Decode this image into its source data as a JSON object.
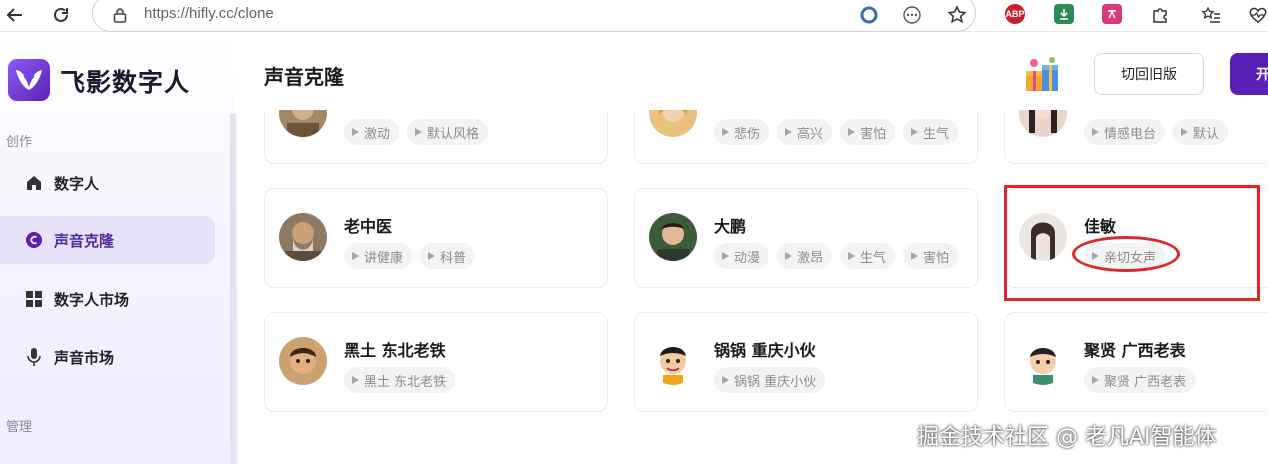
{
  "browser": {
    "url": "https://hifly.cc/clone",
    "extensions": [
      "ABP",
      "download",
      "translate",
      "puzzle",
      "favorites",
      "heartbeat"
    ]
  },
  "brand": {
    "name": "飞影数字人"
  },
  "sidebar": {
    "section_create": "创作",
    "section_manage": "管理",
    "items": [
      {
        "label": "数字人",
        "icon": "home-icon",
        "active": false
      },
      {
        "label": "声音克隆",
        "icon": "voice-clone-icon",
        "active": true
      },
      {
        "label": "数字人市场",
        "icon": "grid-icon",
        "active": false
      },
      {
        "label": "声音市场",
        "icon": "microphone-icon",
        "active": false
      }
    ]
  },
  "header": {
    "title": "声音克隆",
    "back_label": "切回旧版",
    "open_label": "开"
  },
  "cards": [
    {
      "name": "",
      "tags": [
        "激动",
        "默认风格"
      ]
    },
    {
      "name": "",
      "tags": [
        "悲伤",
        "高兴",
        "害怕",
        "生气"
      ]
    },
    {
      "name": "",
      "tags": [
        "情感电台",
        "默认"
      ]
    },
    {
      "name": "老中医",
      "tags": [
        "讲健康",
        "科普"
      ]
    },
    {
      "name": "大鹏",
      "tags": [
        "动漫",
        "激昂",
        "生气",
        "害怕"
      ]
    },
    {
      "name": "佳敏",
      "tags": [
        "亲切女声"
      ]
    },
    {
      "name": "黑土 东北老铁",
      "tags": [
        "黑土 东北老铁"
      ]
    },
    {
      "name": "锅锅 重庆小伙",
      "tags": [
        "锅锅 重庆小伙"
      ]
    },
    {
      "name": "聚贤 广西老表",
      "tags": [
        "聚贤 广西老表"
      ]
    }
  ],
  "watermark": "掘金技术社区 @ 老凡AI智能体",
  "colors": {
    "accent": "#5a1fb4",
    "active_bg": "#e8e2f8",
    "highlight": "#e0262a"
  }
}
